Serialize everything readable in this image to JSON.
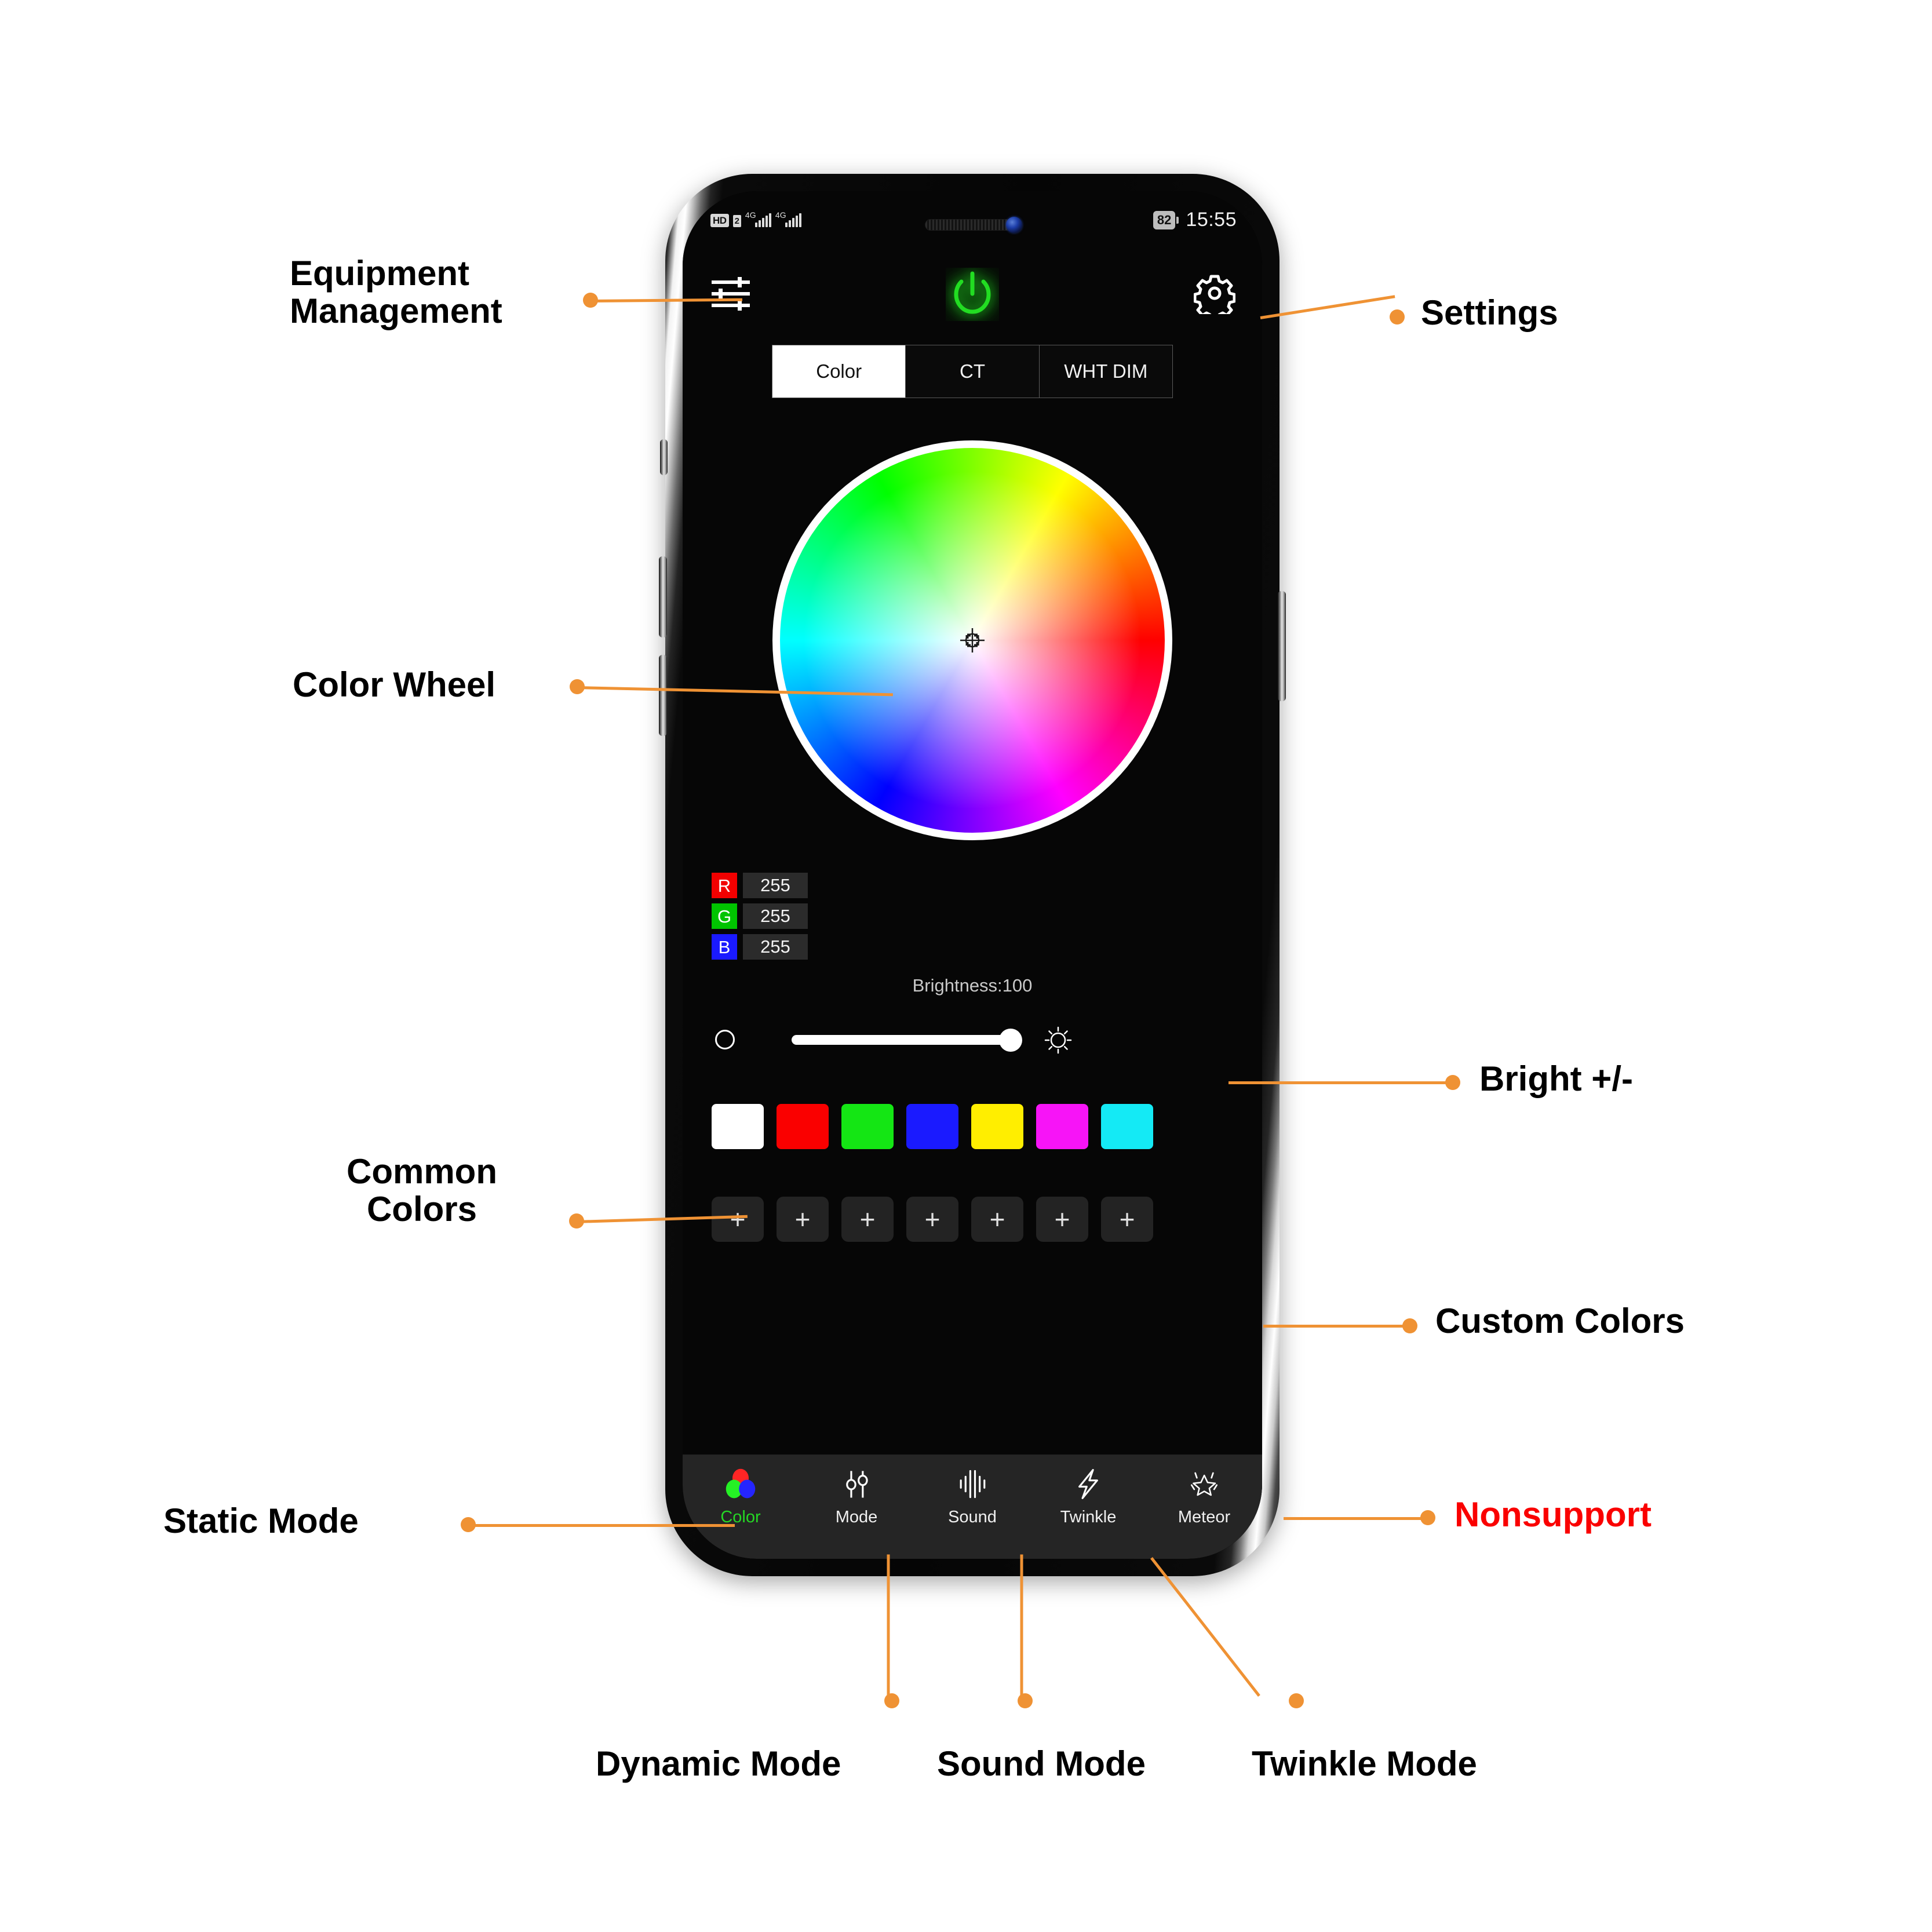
{
  "phone": {
    "status_bar": {
      "hd_badge": "HD",
      "sim_badge": "2",
      "network_1": "4G",
      "network_2": "4G",
      "battery": "82",
      "time": "15:55"
    },
    "appbar": {
      "equipment_icon": "sliders-icon",
      "power_icon": "power-icon",
      "settings_icon": "gear-icon",
      "power_color": "#22cc22"
    },
    "tabs": [
      {
        "label": "Color",
        "active": true
      },
      {
        "label": "CT",
        "active": false
      },
      {
        "label": "WHT DIM",
        "active": false
      }
    ],
    "color_wheel": {
      "marker_icon": "crosshair-icon"
    },
    "rgb": [
      {
        "key": "R",
        "value": "255",
        "color": "#f20000"
      },
      {
        "key": "G",
        "value": "255",
        "color": "#00c400"
      },
      {
        "key": "B",
        "value": "255",
        "color": "#1a1aff"
      }
    ],
    "brightness": {
      "label": "Brightness:100",
      "value": 100,
      "min_icon": "dim-circle-icon",
      "max_icon": "sun-icon"
    },
    "common_colors": [
      "#ffffff",
      "#fa0000",
      "#14e614",
      "#1a1aff",
      "#ffee00",
      "#f714f7",
      "#14eaf5"
    ],
    "custom_colors": {
      "add_label": "+",
      "count": 7,
      "slot_color": "#232323"
    },
    "bottom_nav": [
      {
        "label": "Color",
        "icon": "rgb-circles-icon",
        "active": true
      },
      {
        "label": "Mode",
        "icon": "sliders-icon",
        "active": false
      },
      {
        "label": "Sound",
        "icon": "sound-wave-icon",
        "active": false
      },
      {
        "label": "Twinkle",
        "icon": "lightning-bolt-icon",
        "active": false
      },
      {
        "label": "Meteor",
        "icon": "sparkle-star-icon",
        "active": false
      }
    ]
  },
  "annotations": {
    "equipment_management": "Equipment\nManagement",
    "settings": "Settings",
    "color_wheel": "Color Wheel",
    "bright": "Bright +/-",
    "common_colors": "Common\nColors",
    "custom_colors": "Custom Colors",
    "static_mode": "Static Mode",
    "nonsupport": "Nonsupport",
    "dynamic_mode": "Dynamic Mode",
    "sound_mode": "Sound Mode",
    "twinkle_mode": "Twinkle Mode",
    "accent_color": "#ef9234",
    "warning_color": "#fa0000"
  }
}
